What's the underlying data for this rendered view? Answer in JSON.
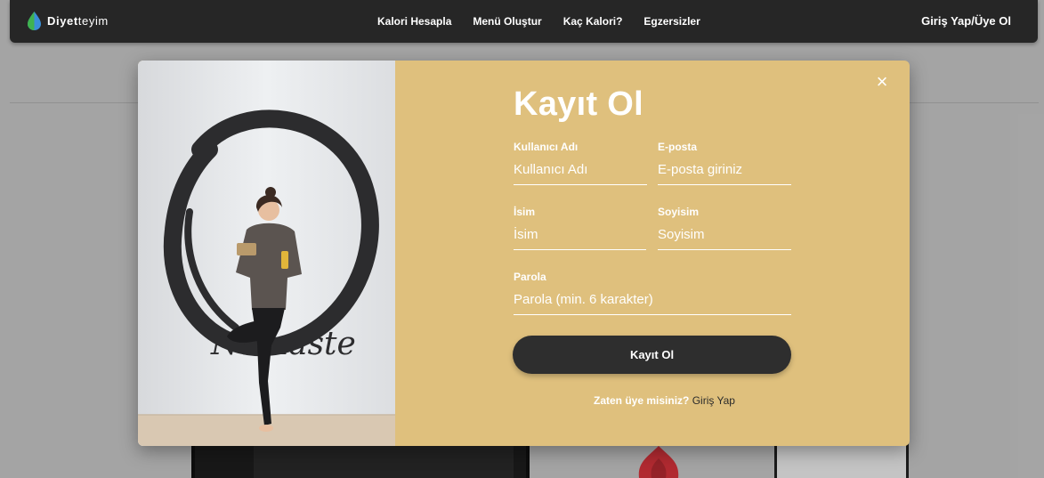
{
  "navbar": {
    "logo_brand_bold": "Diyet",
    "logo_brand_rest": "teyim",
    "links": [
      "Kalori Hesapla",
      "Menü Oluştur",
      "Kaç Kalori?",
      "Egzersizler"
    ],
    "login_label": "Giriş Yap/Üye Ol"
  },
  "modal": {
    "title": "Kayıt Ol",
    "close_icon": "×",
    "image_caption": "Namaste",
    "fields": {
      "username": {
        "label": "Kullanıcı Adı",
        "placeholder": "Kullanıcı Adı",
        "value": ""
      },
      "email": {
        "label": "E-posta",
        "placeholder": "E-posta giriniz",
        "value": ""
      },
      "first_name": {
        "label": "İsim",
        "placeholder": "İsim",
        "value": ""
      },
      "last_name": {
        "label": "Soyisim",
        "placeholder": "Soyisim",
        "value": ""
      },
      "password": {
        "label": "Parola",
        "placeholder": "Parola (min. 6 karakter)",
        "value": ""
      }
    },
    "submit_label": "Kayıt Ol",
    "footer_question": "Zaten üye misiniz?",
    "footer_link": "Giriş Yap"
  },
  "colors": {
    "navbar_bg": "#262626",
    "modal_bg": "#dfc07d",
    "button_bg": "#2e2e2e",
    "logo_leaf_green": "#3fb34f",
    "logo_leaf_blue": "#3a8fd8"
  },
  "icons": {
    "logo": "leaf-drop-icon",
    "close": "close-icon"
  }
}
